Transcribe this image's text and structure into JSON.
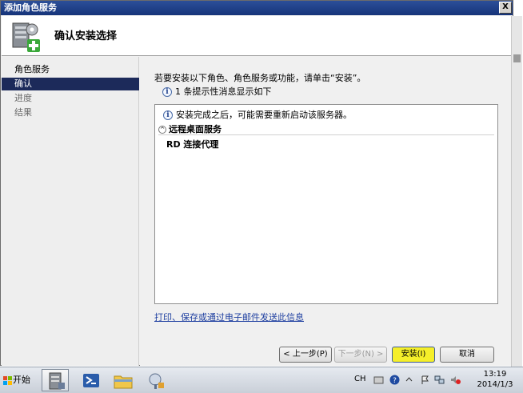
{
  "window": {
    "title": "添加角色服务",
    "close_label": "X"
  },
  "header": {
    "title": "确认安装选择"
  },
  "nav": {
    "items": [
      {
        "label": "角色服务",
        "state": "done"
      },
      {
        "label": "确认",
        "state": "active"
      },
      {
        "label": "进度",
        "state": "pending"
      },
      {
        "label": "结果",
        "state": "pending"
      }
    ]
  },
  "content": {
    "instruction": "若要安装以下角色、角色服务或功能，请单击“安装”。",
    "message_count": "1 条提示性消息显示如下",
    "notice": "安装完成之后，可能需要重新启动该服务器。",
    "section_title": "远程桌面服务",
    "section_item": "RD 连接代理",
    "link": "打印、保存或通过电子邮件发送此信息"
  },
  "buttons": {
    "prev": "< 上一步(P)",
    "next": "下一步(N) >",
    "install": "安装(I)",
    "cancel": "取消"
  },
  "taskbar": {
    "start_label": "开始",
    "lang": "CH",
    "time": "13:19",
    "date": "2014/1/3"
  },
  "colors": {
    "title_bar": "#1f3f8a",
    "nav_active": "#1c2a5a",
    "install_highlight": "#f5ef2a",
    "link": "#1e3fa0"
  }
}
